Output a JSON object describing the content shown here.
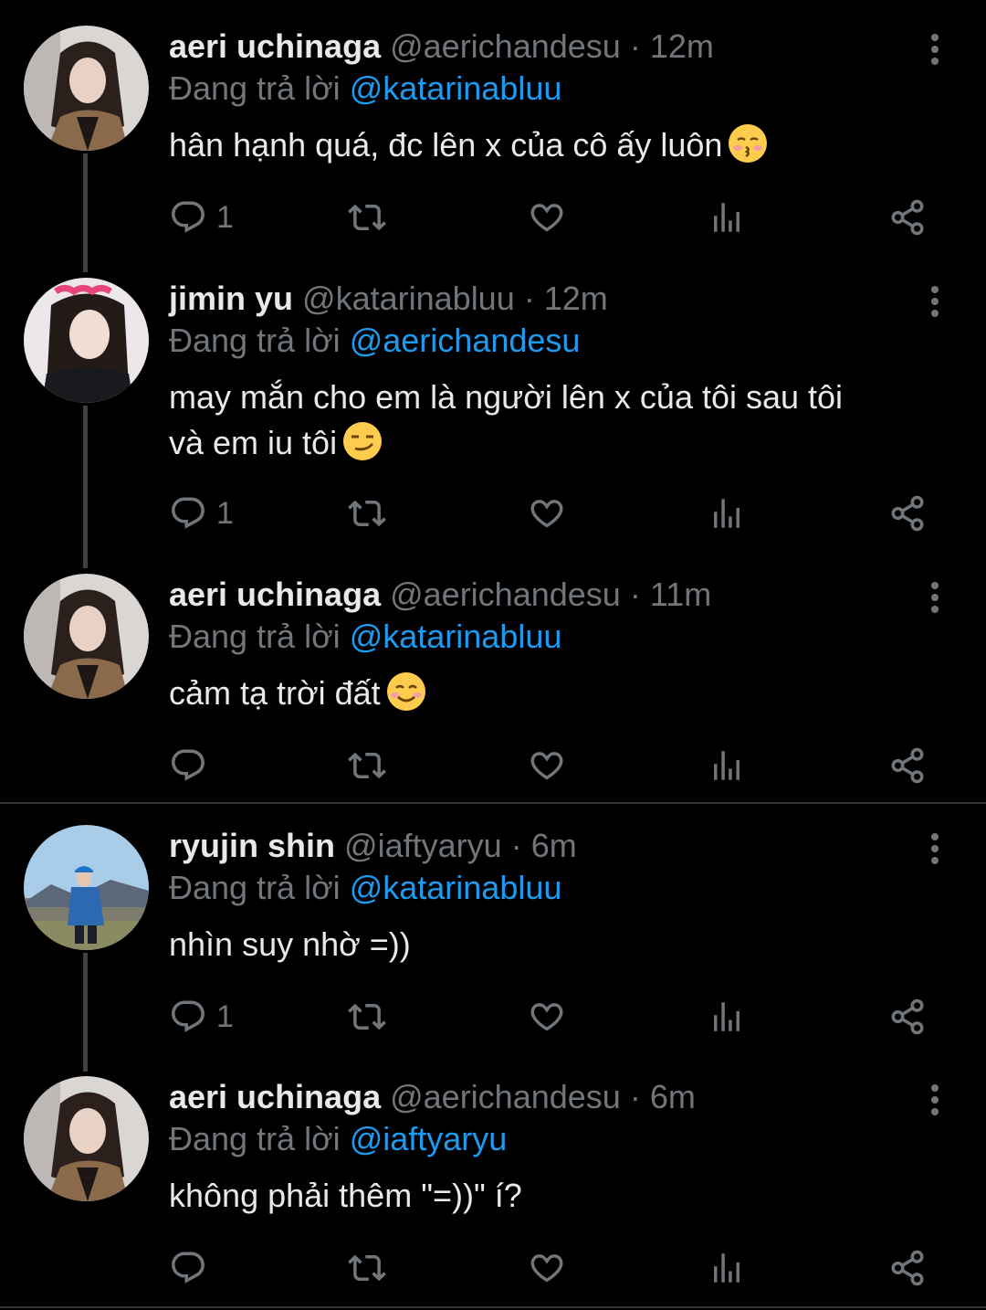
{
  "tweets": [
    {
      "display_name": "aeri uchinaga",
      "handle": "@aerichandesu",
      "separator": "·",
      "time": "12m",
      "reply_prefix": "Đang trả lời",
      "reply_to": "@katarinabluu",
      "text": "hân hạnh quá, đc lên x của cô ấy luôn",
      "emoji": "kissing-closed-eyes-emoji",
      "reply_count": "1"
    },
    {
      "display_name": "jimin yu",
      "handle": "@katarinabluu",
      "separator": "·",
      "time": "12m",
      "reply_prefix": "Đang trả lời",
      "reply_to": "@aerichandesu",
      "text_line1": "may mắn cho em là người lên x của tôi sau tôi",
      "text_line2": "và em iu tôi",
      "emoji": "smirking-face-emoji",
      "reply_count": "1"
    },
    {
      "display_name": "aeri uchinaga",
      "handle": "@aerichandesu",
      "separator": "·",
      "time": "11m",
      "reply_prefix": "Đang trả lời",
      "reply_to": "@katarinabluu",
      "text": "cảm tạ trời đất",
      "emoji": "smiling-face-emoji",
      "reply_count": ""
    },
    {
      "display_name": "ryujin shin",
      "handle": "@iaftyaryu",
      "separator": "·",
      "time": "6m",
      "reply_prefix": "Đang trả lời",
      "reply_to": "@katarinabluu",
      "text": "nhìn suy nhờ =))",
      "reply_count": "1"
    },
    {
      "display_name": "aeri uchinaga",
      "handle": "@aerichandesu",
      "separator": "·",
      "time": "6m",
      "reply_prefix": "Đang trả lời",
      "reply_to": "@iaftyaryu",
      "text": "không phải thêm \"=))\" í?",
      "reply_count": ""
    }
  ],
  "colors": {
    "background": "#000000",
    "text": "#e7e9ea",
    "muted": "#71767b",
    "mention": "#1d9bf0",
    "thread_line": "#3d4145"
  }
}
